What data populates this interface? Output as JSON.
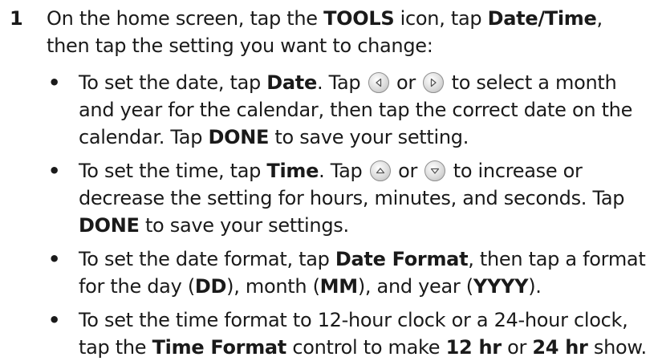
{
  "step": {
    "number": "1",
    "t1": "On the home screen, tap the ",
    "t2": "TOOLS",
    "t3": " icon, tap ",
    "t4": "Date/Time",
    "t5": ", then tap the setting you want to change:"
  },
  "bullets": [
    {
      "a1": "To set the date, tap ",
      "a2": "Date",
      "a3": ". Tap ",
      "a4": " or ",
      "a5": " to select a month and year for the calendar, then tap the correct date on the calendar. Tap ",
      "a6": "DONE",
      "a7": " to save your setting.",
      "icon1": "left-arrow-icon",
      "icon2": "right-arrow-icon"
    },
    {
      "a1": "To set the time, tap ",
      "a2": "Time",
      "a3": ". Tap ",
      "a4": " or ",
      "a5": " to increase or decrease the setting for hours, minutes, and seconds. Tap ",
      "a6": "DONE",
      "a7": " to save your settings.",
      "icon1": "up-arrow-icon",
      "icon2": "down-arrow-icon"
    },
    {
      "b1": "To set the date format, tap ",
      "b2": "Date Format",
      "b3": ", then tap a format for the day (",
      "b4": "DD",
      "b5": "), month (",
      "b6": "MM",
      "b7": "), and year (",
      "b8": "YYYY",
      "b9": ")."
    },
    {
      "c1": "To set the time format to 12-hour clock or a 24-hour clock, tap the ",
      "c2": "Time Format",
      "c3": " control to make ",
      "c4": "12 hr",
      "c5": " or ",
      "c6": "24 hr",
      "c7": " show."
    }
  ],
  "bullet_char": "•"
}
